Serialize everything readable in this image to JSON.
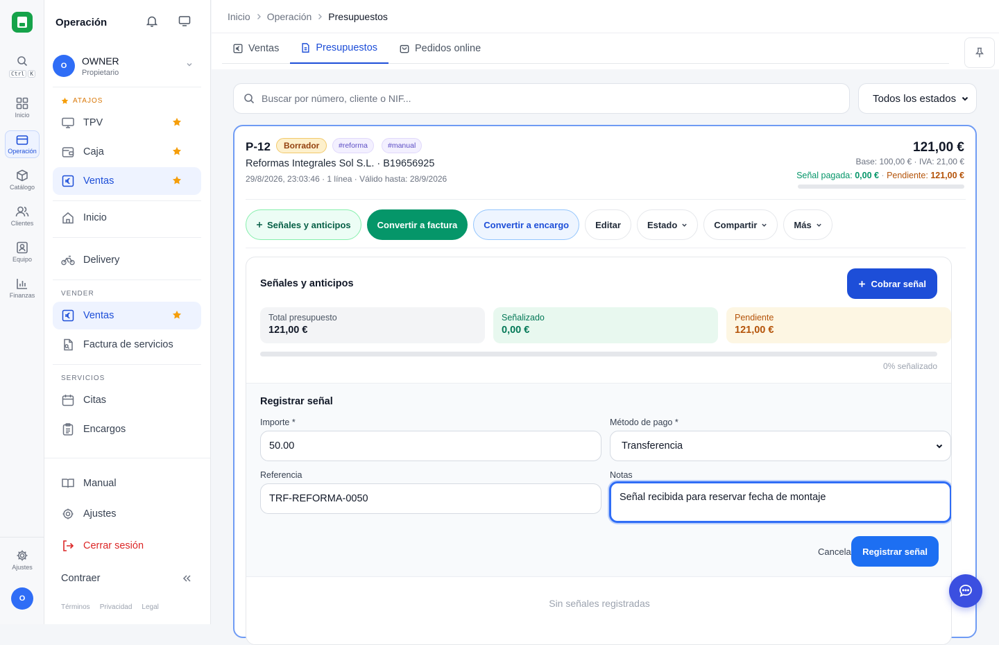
{
  "rail": {
    "search_label": "",
    "kbd": [
      "Ctrl",
      "K"
    ],
    "items": [
      {
        "label": "Inicio",
        "icon": "grid-icon"
      },
      {
        "label": "Operación",
        "icon": "card-icon"
      },
      {
        "label": "Catálogo",
        "icon": "box-icon"
      },
      {
        "label": "Clientes",
        "icon": "users-icon"
      },
      {
        "label": "Equipo",
        "icon": "badge-icon"
      },
      {
        "label": "Finanzas",
        "icon": "bar-chart-icon"
      }
    ],
    "settings_label": "Ajustes",
    "avatar_letter": "O"
  },
  "sidebar": {
    "title": "Operación",
    "user": {
      "initial": "O",
      "name": "OWNER",
      "role": "Propietario"
    },
    "shortcuts_label": "ATAJOS",
    "shortcuts": [
      {
        "label": "TPV",
        "icon": "monitor-icon"
      },
      {
        "label": "Caja",
        "icon": "wallet-icon"
      },
      {
        "label": "Ventas",
        "icon": "euro-icon"
      }
    ],
    "inicio": "Inicio",
    "delivery": "Delivery",
    "vender_label": "VENDER",
    "vender": [
      {
        "label": "Ventas",
        "icon": "euro-icon"
      },
      {
        "label": "Factura de servicios",
        "icon": "invoice-icon"
      }
    ],
    "servicios_label": "SERVICIOS",
    "servicios": [
      {
        "label": "Citas",
        "icon": "calendar-icon"
      },
      {
        "label": "Encargos",
        "icon": "clipboard-icon"
      }
    ],
    "manual": "Manual",
    "ajustes": "Ajustes",
    "logout": "Cerrar sesión",
    "collapse": "Contraer",
    "footer_links": [
      "Términos",
      "Privacidad",
      "Legal"
    ]
  },
  "breadcrumb": [
    "Inicio",
    "Operación",
    "Presupuestos"
  ],
  "tabs": [
    {
      "label": "Ventas",
      "active": false
    },
    {
      "label": "Presupuestos",
      "active": true
    },
    {
      "label": "Pedidos online",
      "active": false
    }
  ],
  "search": {
    "placeholder": "Buscar por número, cliente o NIF..."
  },
  "status_filter": {
    "selected": "Todos los estados"
  },
  "quote": {
    "number": "P-12",
    "status": "Borrador",
    "tags": [
      "#reforma",
      "#manual"
    ],
    "client": "Reformas Integrales Sol S.L. · B19656925",
    "meta": "29/8/2026, 23:03:46 · 1 línea · Válido hasta: 28/9/2026",
    "total": "121,00 €",
    "base_line": "Base: 100,00 € · IVA: 21,00 €",
    "paid_label": "Señal pagada:",
    "paid_value": "0,00 €",
    "sep": " · ",
    "pending_label": "Pendiente:",
    "pending_value": "121,00 €",
    "paid_fraction": 0
  },
  "actions": {
    "senales": "Señales y anticipos",
    "convert_invoice": "Convertir a factura",
    "convert_order": "Convertir a encargo",
    "edit": "Editar",
    "status": "Estado",
    "share": "Compartir",
    "more": "Más"
  },
  "panel": {
    "title": "Señales y anticipos",
    "cobrar": "Cobrar señal",
    "stats": [
      {
        "label": "Total presupuesto",
        "value": "121,00 €"
      },
      {
        "label": "Señalizado",
        "value": "0,00 €"
      },
      {
        "label": "Pendiente",
        "value": "121,00 €"
      }
    ],
    "progress_fraction": 0,
    "progress_text": "0% señalizado",
    "form": {
      "title": "Registrar señal",
      "amount_label": "Importe *",
      "amount_value": "50.00",
      "method_label": "Método de pago *",
      "method_value": "Transferencia",
      "ref_label": "Referencia",
      "ref_value": "TRF-REFORMA-0050",
      "notes_label": "Notas",
      "notes_value": "Señal recibida para reservar fecha de montaje",
      "cancel": "Cancelar",
      "submit": "Registrar señal"
    },
    "empty": "Sin señales registradas"
  },
  "colors": {
    "accent": "#1d4ed8",
    "green": "#059669",
    "warning": "#b45309"
  }
}
